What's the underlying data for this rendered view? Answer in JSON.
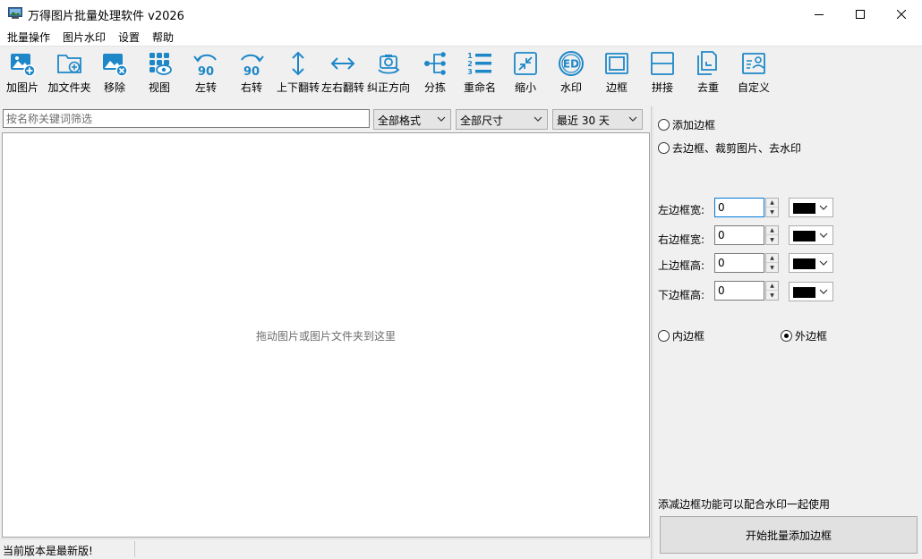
{
  "window": {
    "title": "万得图片批量处理软件 v2026"
  },
  "menu": [
    "批量操作",
    "图片水印",
    "设置",
    "帮助"
  ],
  "toolbar": [
    {
      "label": "加图片",
      "icon": "add-image-icon"
    },
    {
      "label": "加文件夹",
      "icon": "add-folder-icon"
    },
    {
      "label": "移除",
      "icon": "remove-image-icon"
    },
    {
      "label": "视图",
      "icon": "view-grid-icon"
    },
    {
      "label": "左转",
      "icon": "rotate-left-icon"
    },
    {
      "label": "右转",
      "icon": "rotate-right-icon"
    },
    {
      "label": "上下翻转",
      "icon": "flip-vertical-icon"
    },
    {
      "label": "左右翻转",
      "icon": "flip-horizontal-icon"
    },
    {
      "label": "纠正方向",
      "icon": "correct-orientation-icon"
    },
    {
      "label": "分拣",
      "icon": "sort-icon"
    },
    {
      "label": "重命名",
      "icon": "rename-list-icon"
    },
    {
      "label": "缩小",
      "icon": "shrink-icon"
    },
    {
      "label": "水印",
      "icon": "watermark-icon"
    },
    {
      "label": "边框",
      "icon": "border-icon"
    },
    {
      "label": "拼接",
      "icon": "stitch-icon"
    },
    {
      "label": "去重",
      "icon": "dedupe-icon"
    },
    {
      "label": "自定义",
      "icon": "custom-icon"
    }
  ],
  "filters": {
    "search_placeholder": "按名称关键词筛选",
    "format": "全部格式",
    "size": "全部尺寸",
    "date": "最近 30 天"
  },
  "drop_hint": "拖动图片或图片文件夹到这里",
  "status": "当前版本是最新版!",
  "panel": {
    "mode_add": "添加边框",
    "mode_remove": "去边框、裁剪图片、去水印",
    "fields": [
      {
        "label": "左边框宽:",
        "value": "0",
        "color": "#000000"
      },
      {
        "label": "右边框宽:",
        "value": "0",
        "color": "#000000"
      },
      {
        "label": "上边框高:",
        "value": "0",
        "color": "#000000"
      },
      {
        "label": "下边框高:",
        "value": "0",
        "color": "#000000"
      }
    ],
    "inner_border": "内边框",
    "outer_border": "外边框",
    "selected_border": "外边框",
    "hint": "添减边框功能可以配合水印一起使用",
    "start_button": "开始批量添加边框"
  },
  "colors": {
    "accent": "#1e87c8",
    "focus": "#0078d7"
  }
}
